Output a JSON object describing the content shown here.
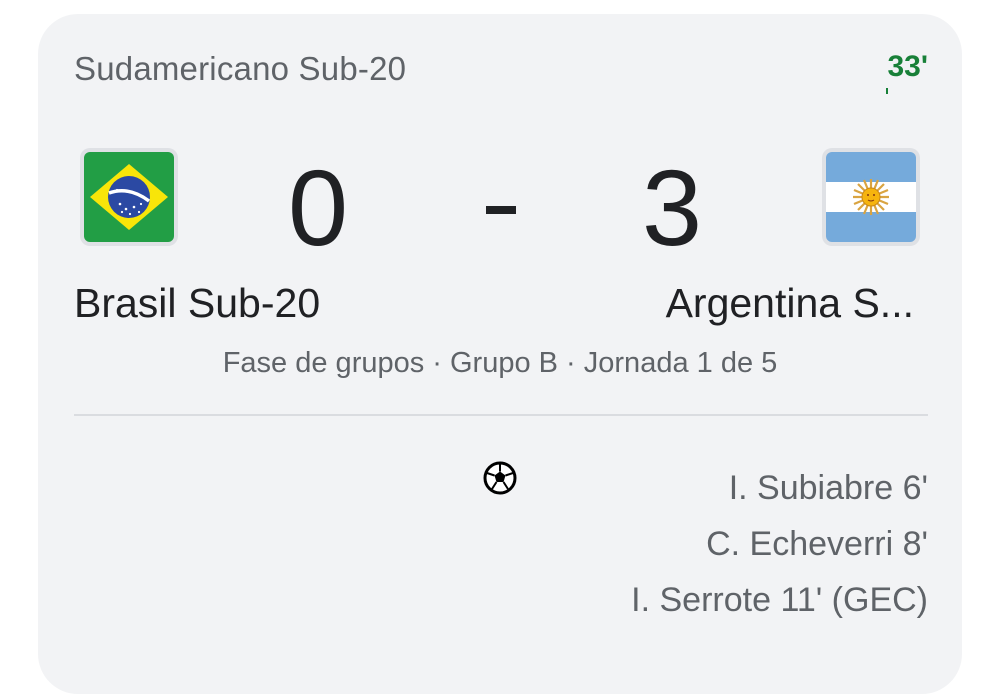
{
  "match": {
    "competition": "Sudamericano Sub-20",
    "live_minute": "33'",
    "stage": "Fase de grupos · Grupo B · Jornada 1 de 5",
    "home": {
      "name": "Brasil Sub-20",
      "score": "0",
      "flag_icon": "brazil-flag-icon"
    },
    "away": {
      "name": "Argentina S...",
      "score": "3",
      "flag_icon": "argentina-flag-icon"
    },
    "score_separator": "-",
    "goal_icon": "soccer-ball-icon",
    "away_scorers": [
      "I. Subiabre 6'",
      "C. Echeverri 8'",
      "I. Serrote 11' (GEC)"
    ]
  },
  "colors": {
    "card_background": "#f2f3f5",
    "live_accent": "#188038",
    "primary_text": "#202124",
    "secondary_text": "#5f6368"
  }
}
